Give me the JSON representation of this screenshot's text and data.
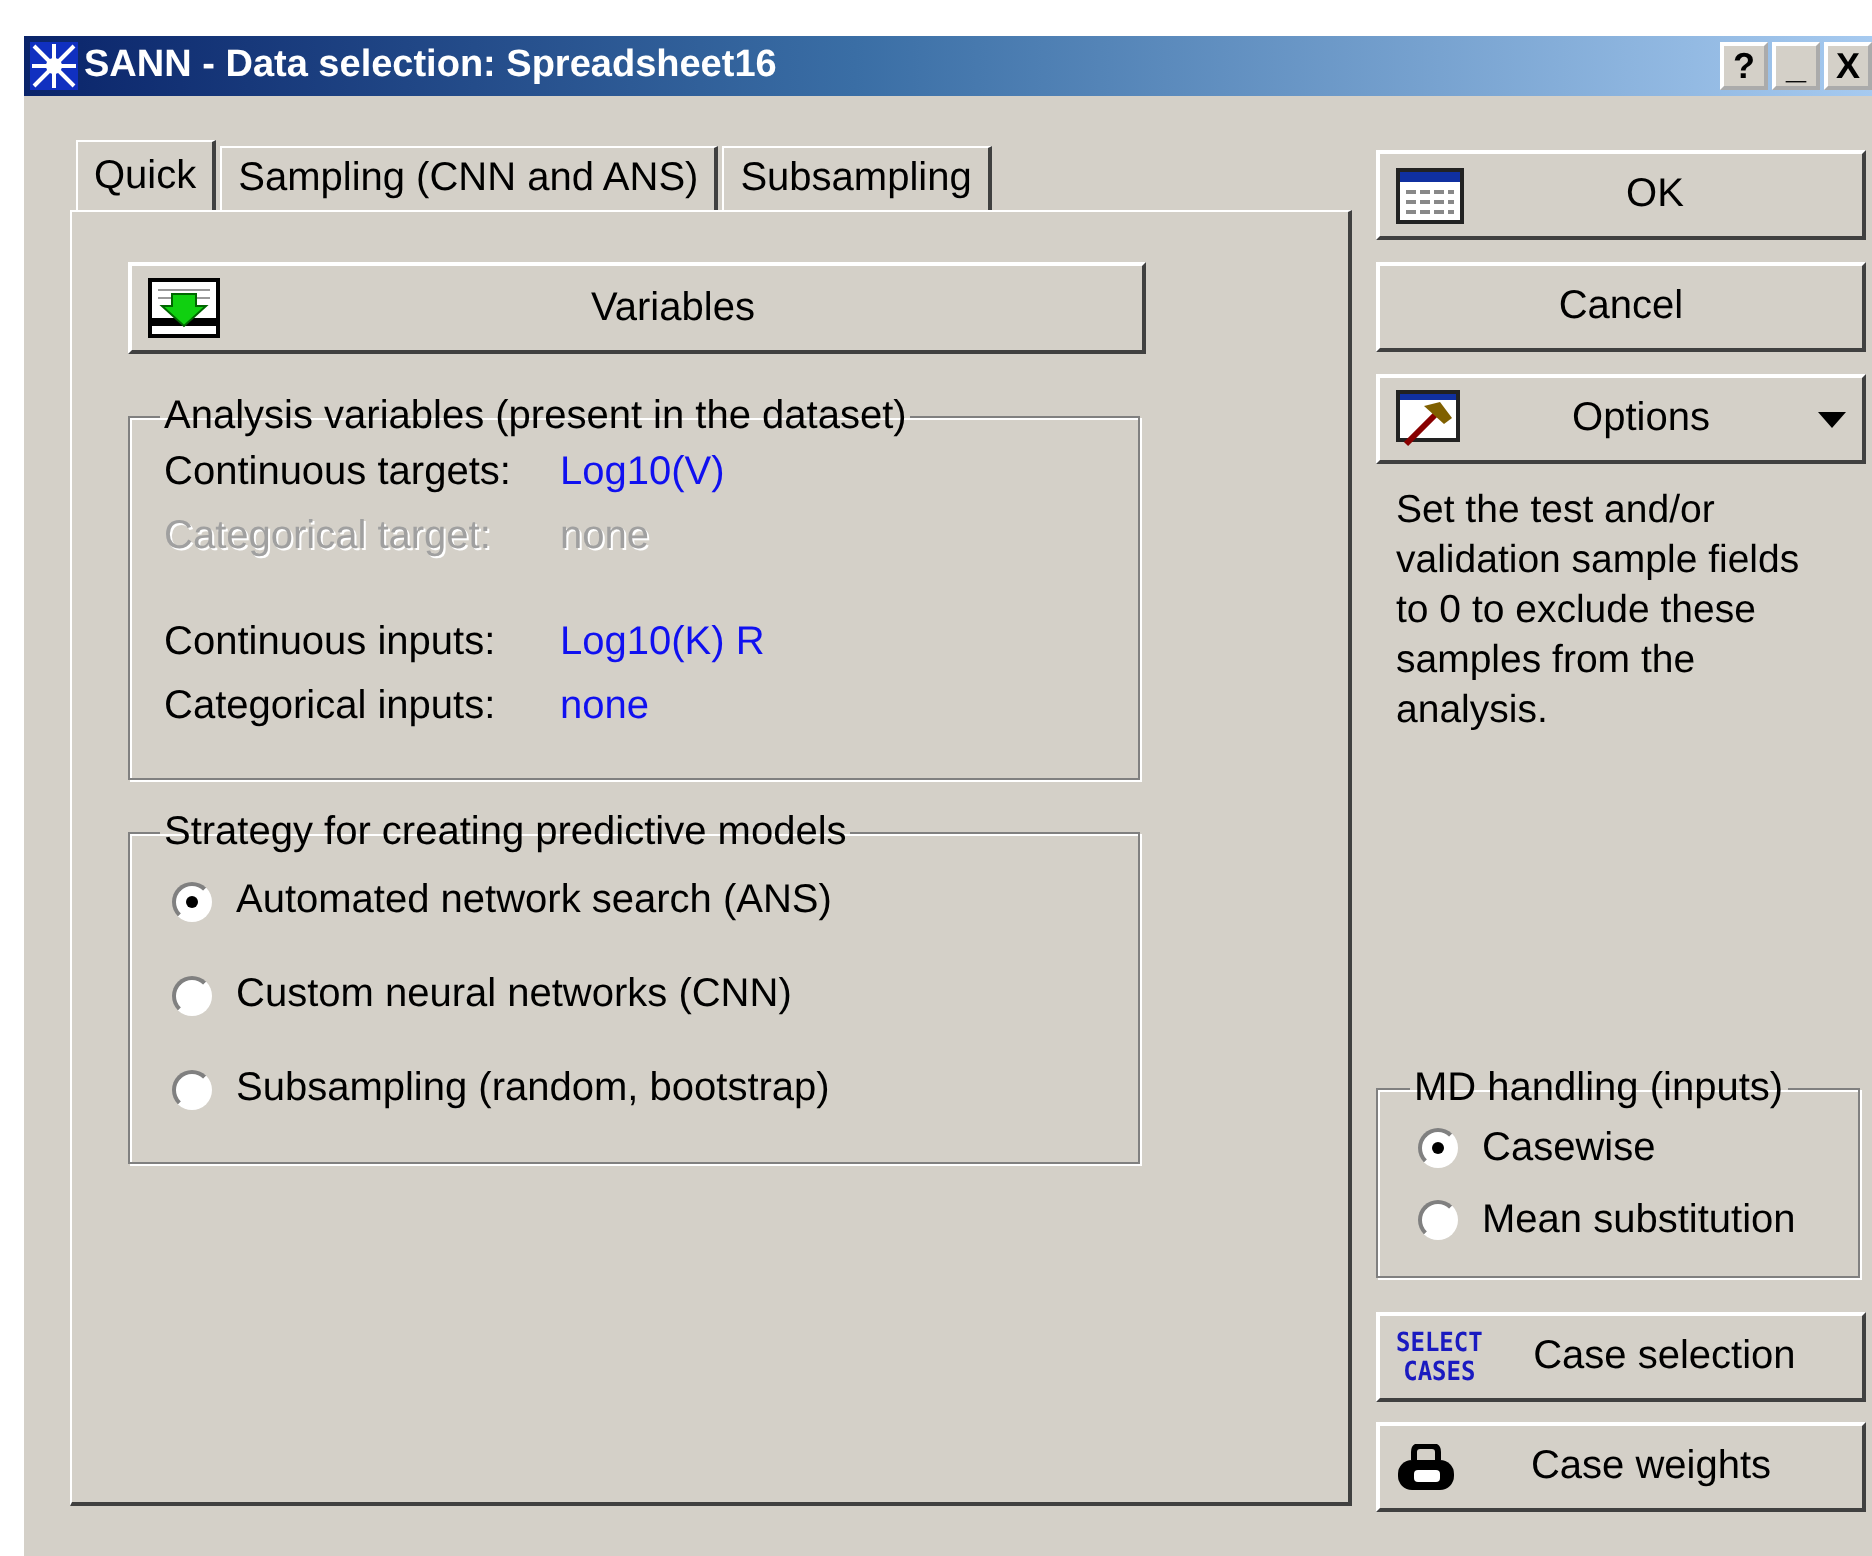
{
  "window": {
    "title": "SANN - Data selection: Spreadsheet16",
    "title_buttons": [
      "?",
      "_",
      "X"
    ]
  },
  "tabs": [
    {
      "label": "Quick",
      "selected": true
    },
    {
      "label": "Sampling (CNN and ANS)",
      "selected": false
    },
    {
      "label": "Subsampling",
      "selected": false
    }
  ],
  "variables_button": {
    "label": "Variables"
  },
  "analysis_group": {
    "title": "Analysis variables (present in the dataset)",
    "rows": [
      {
        "label": "Continuous targets:",
        "value": "Log10(V)",
        "disabled": false
      },
      {
        "label": "Categorical target:",
        "value": "none",
        "disabled": true
      },
      {
        "label": "Continuous inputs:",
        "value": "Log10(K) R",
        "disabled": false
      },
      {
        "label": "Categorical inputs:",
        "value": "none",
        "disabled": false
      }
    ]
  },
  "strategy_group": {
    "title": "Strategy for creating predictive models",
    "options": [
      {
        "label": "Automated network search (ANS)",
        "selected": true
      },
      {
        "label": "Custom neural networks (CNN)",
        "selected": false
      },
      {
        "label": "Subsampling (random, bootstrap)",
        "selected": false
      }
    ]
  },
  "side_buttons": [
    {
      "kind": "ok",
      "label": "OK"
    },
    {
      "kind": "plain",
      "label": "Cancel"
    },
    {
      "kind": "options",
      "label": "Options"
    }
  ],
  "hint": "Set the test and/or validation sample fields to 0 to exclude these samples from the analysis.",
  "md_group": {
    "title": "MD handling (inputs)",
    "options": [
      {
        "label": "Casewise",
        "selected": true
      },
      {
        "label": "Mean substitution",
        "selected": false
      }
    ]
  },
  "bottom_buttons": [
    {
      "kind": "select_cases",
      "icon_text": [
        "SELECT",
        "CASES"
      ],
      "label": "Case selection"
    },
    {
      "kind": "weights",
      "label": "Case weights"
    }
  ]
}
